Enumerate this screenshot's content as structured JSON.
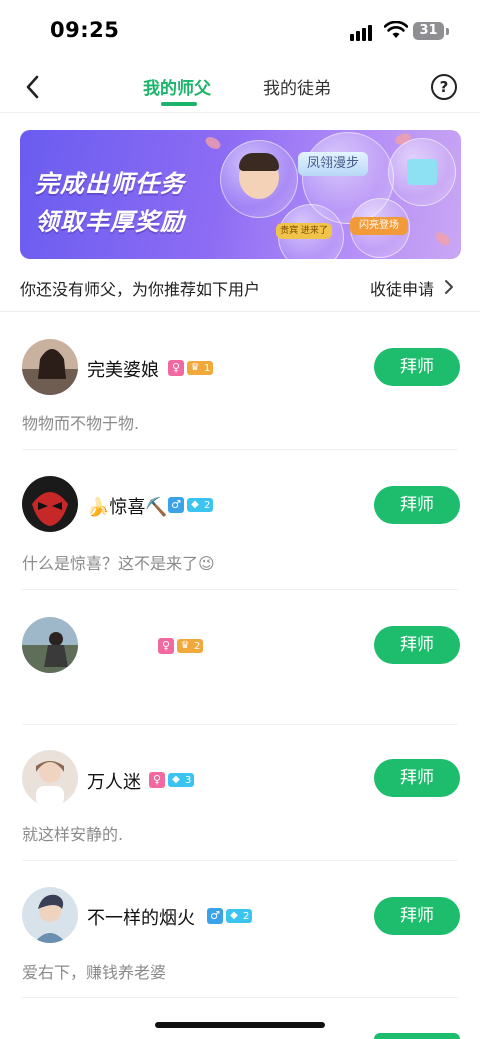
{
  "status_bar": {
    "time": "09:25",
    "battery": "31"
  },
  "nav": {
    "tabs": [
      {
        "label": "我的师父",
        "active": true
      },
      {
        "label": "我的徒弟",
        "active": false
      }
    ],
    "help_label": "?"
  },
  "banner": {
    "line1": "完成出师任务",
    "line2": "领取丰厚奖励",
    "tag_fengxiang": "凤翎漫步",
    "tag_jinchang": "贵宾 进来了",
    "tag_shanliang": "闪亮登场"
  },
  "recommend": {
    "text": "你还没有师父，为你推荐如下用户",
    "link": "收徒申请"
  },
  "users": [
    {
      "name": "完美婆娘",
      "gender": "female",
      "gender_symbol": "♀",
      "level_type": "gold",
      "level_icon": "♛",
      "level": "1",
      "bio": "物物而不物于物.",
      "button": "拜师"
    },
    {
      "name": "🍌惊喜⛏️",
      "gender": "male",
      "gender_symbol": "♂",
      "level_type": "blue",
      "level_icon": "◆",
      "level": "2",
      "bio": "什么是惊喜？这不是来了😉",
      "button": "拜师"
    },
    {
      "name": "",
      "gender": "female",
      "gender_symbol": "♀",
      "level_type": "gold",
      "level_icon": "♛",
      "level": "2",
      "bio": "",
      "button": "拜师"
    },
    {
      "name": "万人迷",
      "gender": "female",
      "gender_symbol": "♀",
      "level_type": "blue",
      "level_icon": "◆",
      "level": "3",
      "bio": "就这样安静的.",
      "button": "拜师"
    },
    {
      "name": "不一样的烟火",
      "gender": "male",
      "gender_symbol": "♂",
      "level_type": "blue",
      "level_icon": "◆",
      "level": "2",
      "bio": "爱右下，赚钱养老婆",
      "button": "拜师"
    }
  ],
  "colors": {
    "accent": "#1bb46a",
    "button": "#1ebd6e",
    "female": "#f06aa0",
    "male": "#3aa2e8",
    "gold_level": "#f2a93b",
    "blue_level": "#3cc4f0"
  }
}
